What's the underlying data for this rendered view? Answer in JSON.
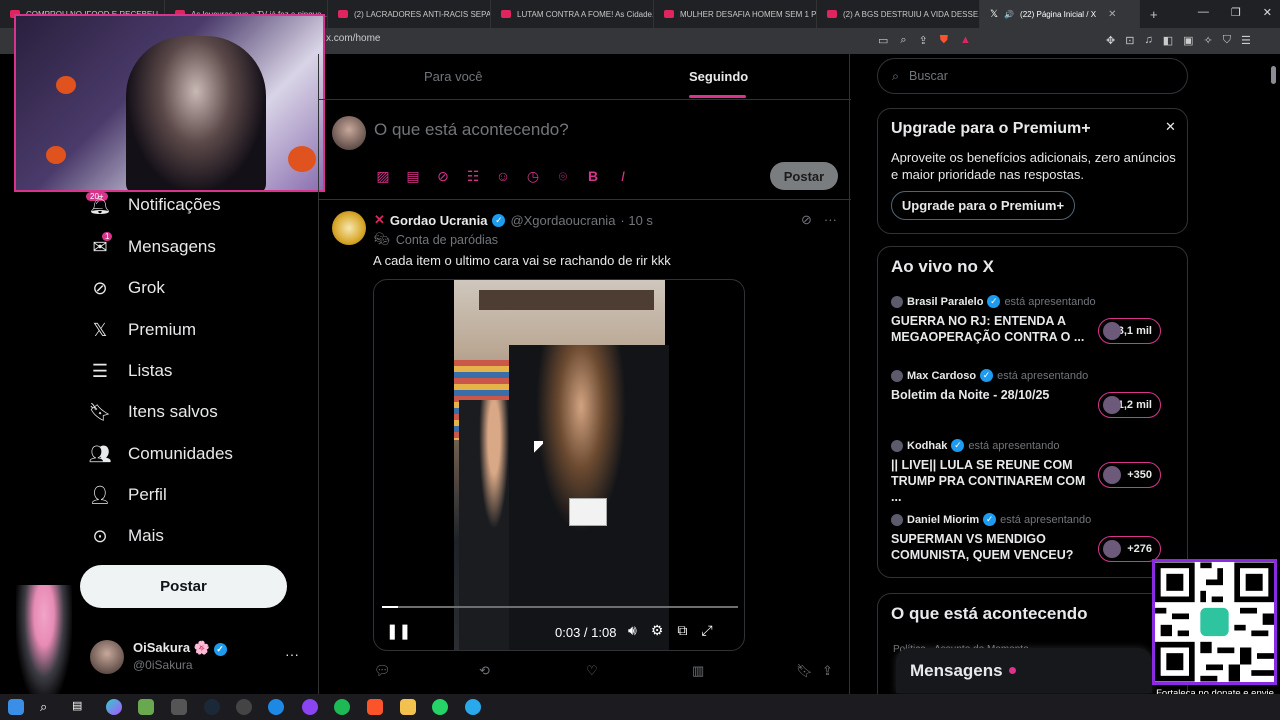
{
  "browser": {
    "tabs": [
      {
        "title": "COMPROU NO IFOOD E RECEBEU..."
      },
      {
        "title": "As loucuras que a TV já fez e pingue..."
      },
      {
        "title": "(2) LACRADORES ANTI-RACIS SEPAR..."
      },
      {
        "title": "LUTAM CONTRA A FOME! As Cidade..."
      },
      {
        "title": "MULHER DESAFIA HOMEM SEM 1 P..."
      },
      {
        "title": "(2) A BGS DESTRUIU A VIDA DESSE..."
      },
      {
        "title": "(22) Página Inicial / X",
        "active": true
      }
    ],
    "new_tab": "+",
    "url": "x.com/home"
  },
  "overlay": {
    "notif_badge": "20+",
    "qr_caption": "Fortaleça no donate e envie sua mensagem!"
  },
  "nav": {
    "items": [
      {
        "label": "Notificações",
        "icon": "bell-icon"
      },
      {
        "label": "Mensagens",
        "icon": "envelope-icon",
        "badge": "1"
      },
      {
        "label": "Grok",
        "icon": "grok-icon"
      },
      {
        "label": "Premium",
        "icon": "x-logo-icon"
      },
      {
        "label": "Listas",
        "icon": "list-icon"
      },
      {
        "label": "Itens salvos",
        "icon": "bookmark-icon"
      },
      {
        "label": "Comunidades",
        "icon": "communities-icon"
      },
      {
        "label": "Perfil",
        "icon": "person-icon"
      },
      {
        "label": "Mais",
        "icon": "more-circle-icon"
      }
    ],
    "post_button": "Postar",
    "account": {
      "name": "OiSakura 🌸",
      "handle": "@0iSakura"
    }
  },
  "feed": {
    "tabs": [
      {
        "label": "Para você"
      },
      {
        "label": "Seguindo",
        "selected": true
      }
    ],
    "composer": {
      "placeholder": "O que está acontecendo?",
      "post_button": "Postar"
    },
    "tweet": {
      "name": "Gordao Ucrania",
      "handle": "@Xgordaoucrania",
      "time": "· 10 s",
      "label": "Conta de paródias",
      "text": "A cada item o ultimo cara vai se rachando de rir kkk",
      "video": {
        "time": "0:03 / 1:08",
        "progress": 0.045
      }
    }
  },
  "sidebar": {
    "search_placeholder": "Buscar",
    "premium": {
      "title": "Upgrade para o Premium+",
      "desc": "Aproveite os benefícios adicionais, zero anúncios e maior prioridade nas respostas.",
      "button": "Upgrade para o Premium+"
    },
    "live": {
      "title": "Ao vivo no X",
      "presenting": "está apresentando",
      "items": [
        {
          "host": "Brasil Paralelo",
          "headline": "GUERRA NO RJ: ENTENDA A MEGAOPERAÇÃO CONTRA O ...",
          "count": "+3,1 mil"
        },
        {
          "host": "Max Cardoso",
          "headline": "Boletim da Noite  - 28/10/25",
          "count": "+1,2 mil"
        },
        {
          "host": "Kodhak",
          "headline": "|| LIVE|| LULA SE REUNE COM TRUMP PRA CONTINAREM COM ...",
          "count": "+350"
        },
        {
          "host": "Daniel Miorim",
          "headline": "SUPERMAN VS MENDIGO COMUNISTA, QUEM VENCEU?",
          "count": "+276"
        }
      ]
    },
    "trends": {
      "title": "O que está acontecendo",
      "sub": "Política · Assunto do Momento"
    },
    "messages_bar": "Mensagens"
  },
  "colors": {
    "accent": "#d8348c",
    "verified": "#1d9bf0",
    "background": "#000000"
  }
}
